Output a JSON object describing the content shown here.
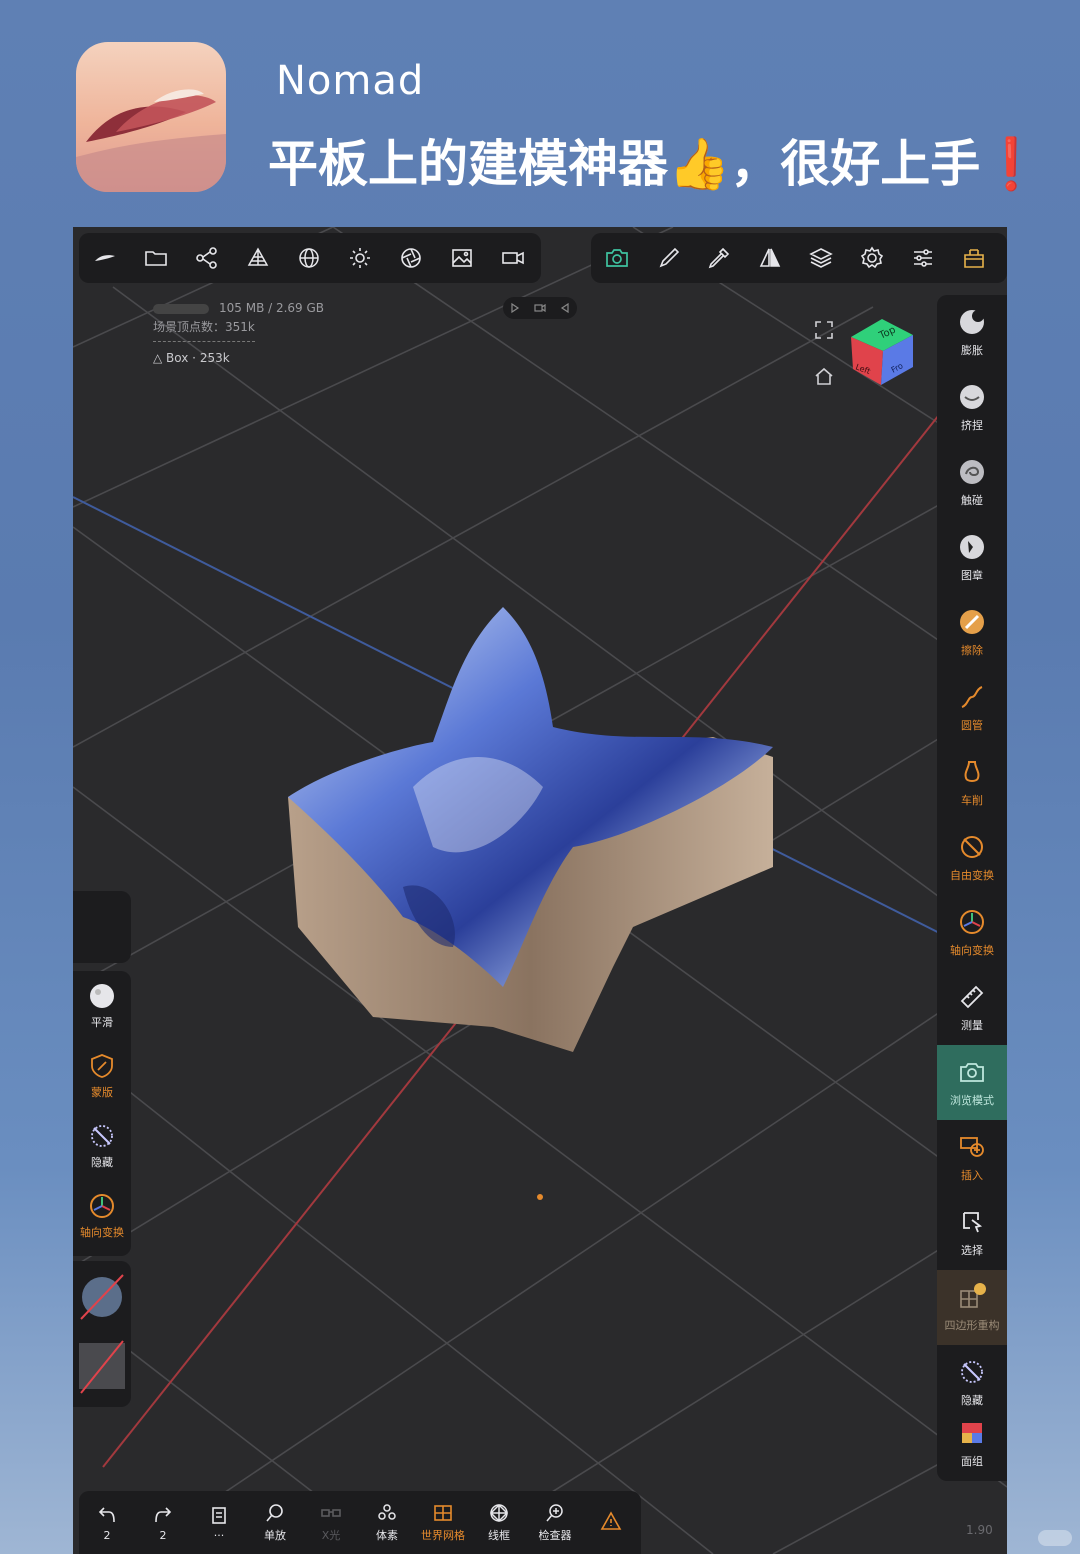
{
  "header": {
    "app_name": "Nomad",
    "headline": "平板上的建模神器👍，很好上手",
    "exclaim": "❗"
  },
  "top_toolbar": {
    "left_icons": [
      "nomad-logo-icon",
      "folder-icon",
      "share-nodes-icon",
      "mesh-pyramid-icon",
      "sphere-wire-icon",
      "sun-icon",
      "aperture-icon",
      "image-icon",
      "video-camera-icon"
    ],
    "right_icons": [
      "camera-icon",
      "brush-icon",
      "dropper-icon",
      "symmetry-icon",
      "layers-icon",
      "gear-icon",
      "sliders-icon",
      "shop-icon"
    ]
  },
  "stats": {
    "memory": "105 MB / 2.69 GB",
    "vertex_count": "场景顶点数：351k",
    "selected_object": "Box",
    "selected_vertices": "253k"
  },
  "gizmo": {
    "top": "Top",
    "left": "Left",
    "front": "Fro"
  },
  "right_toolbar": [
    {
      "label": "膨胀",
      "icon": "inflate-sphere-icon",
      "highlight": "none"
    },
    {
      "label": "挤捏",
      "icon": "pinch-sphere-icon",
      "highlight": "none"
    },
    {
      "label": "触碰",
      "icon": "smudge-sphere-icon",
      "highlight": "none"
    },
    {
      "label": "图章",
      "icon": "stamp-sphere-icon",
      "highlight": "none"
    },
    {
      "label": "擦除",
      "icon": "erase-icon",
      "highlight": "orange"
    },
    {
      "label": "圆管",
      "icon": "tube-icon",
      "highlight": "orange"
    },
    {
      "label": "车削",
      "icon": "lathe-icon",
      "highlight": "orange"
    },
    {
      "label": "自由变换",
      "icon": "free-transform-icon",
      "highlight": "orange"
    },
    {
      "label": "轴向变换",
      "icon": "gizmo-axis-icon",
      "highlight": "orange"
    },
    {
      "label": "测量",
      "icon": "ruler-icon",
      "highlight": "none"
    },
    {
      "label": "浏览模式",
      "icon": "camera-view-icon",
      "highlight": "active"
    },
    {
      "label": "插入",
      "icon": "insert-icon",
      "highlight": "orange"
    },
    {
      "label": "选择",
      "icon": "select-icon",
      "highlight": "none"
    },
    {
      "label": "四边形重构",
      "icon": "quad-remesh-icon",
      "highlight": "shop"
    },
    {
      "label": "隐藏",
      "icon": "hide-icon",
      "highlight": "none"
    },
    {
      "label": "面组",
      "icon": "face-group-icon",
      "highlight": "none"
    }
  ],
  "left_toolbar": [
    {
      "label": "平滑",
      "icon": "smooth-sphere-icon",
      "highlight": "none"
    },
    {
      "label": "蒙版",
      "icon": "mask-shield-icon",
      "highlight": "orange"
    },
    {
      "label": "隐藏",
      "icon": "hide-icon",
      "highlight": "none"
    },
    {
      "label": "轴向变换",
      "icon": "gizmo-axis-icon",
      "highlight": "orange"
    }
  ],
  "bottom_toolbar": [
    {
      "label": "2",
      "icon": "undo-icon",
      "state": "normal"
    },
    {
      "label": "2",
      "icon": "redo-icon",
      "state": "normal"
    },
    {
      "label": "···",
      "icon": "history-list-icon",
      "state": "normal"
    },
    {
      "label": "单放",
      "icon": "search-icon",
      "state": "normal"
    },
    {
      "label": "X光",
      "icon": "xray-glasses-icon",
      "state": "dim"
    },
    {
      "label": "体素",
      "icon": "voxel-icon",
      "state": "normal"
    },
    {
      "label": "世界网格",
      "icon": "world-grid-icon",
      "state": "orange"
    },
    {
      "label": "线框",
      "icon": "wireframe-icon",
      "state": "normal"
    },
    {
      "label": "检查器",
      "icon": "inspector-icon",
      "state": "normal"
    },
    {
      "label": "",
      "icon": "warning-icon",
      "state": "orange"
    }
  ],
  "fps": "1.90",
  "colors": {
    "accent_orange": "#e58a2c",
    "active_green": "#2f6d5e",
    "toolbar_bg": "#1c1c1e",
    "viewport_bg": "#2a2a2c"
  }
}
